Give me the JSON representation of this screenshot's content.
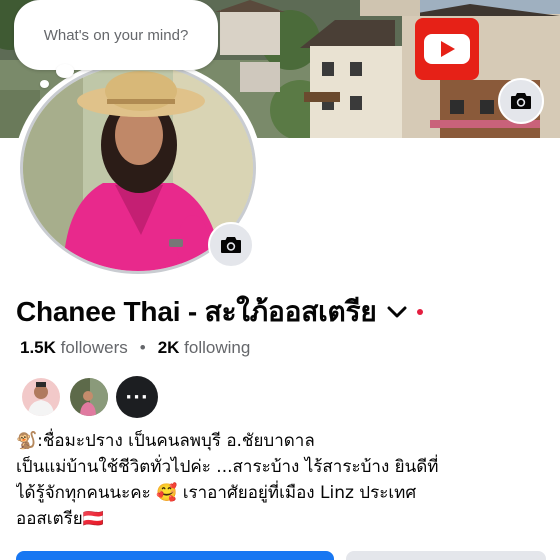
{
  "composer": {
    "placeholder": "What's on your mind?"
  },
  "profile": {
    "name": "Chanee Thai - สะใภ้ออสเตรีย",
    "followers_count": "1.5K",
    "followers_label": "followers",
    "separator": "•",
    "following_count": "2K",
    "following_label": "following",
    "more_friends_glyph": "···"
  },
  "bio": {
    "lines": [
      "🐒:ชื่อมะปราง เป็นคนลพบุรี อ.ชัยบาดาล",
      "เป็นแม่บ้านใช้ชีวิตทั่วไปค่ะ ...สาระบ้าง ไร้สาระบ้าง ยินดีที่",
      "ได้รู้จักทุกคนนะคะ 🥰 เราอาศัยอยู่ที่เมือง Linz ประเทศ",
      "ออสเตรีย🇦🇹"
    ]
  },
  "icons": {
    "cover_camera": "camera-icon",
    "avatar_camera": "camera-icon",
    "name_dropdown": "chevron-down-icon",
    "status": "red-dot-icon",
    "cover_logo": "youtube-icon"
  },
  "colors": {
    "primary": "#1877f2",
    "secondary_button": "#e4e6eb",
    "text": "#050505",
    "muted_text": "#65676b",
    "status_dot": "#e41e3f",
    "youtube_red": "#e62117"
  }
}
